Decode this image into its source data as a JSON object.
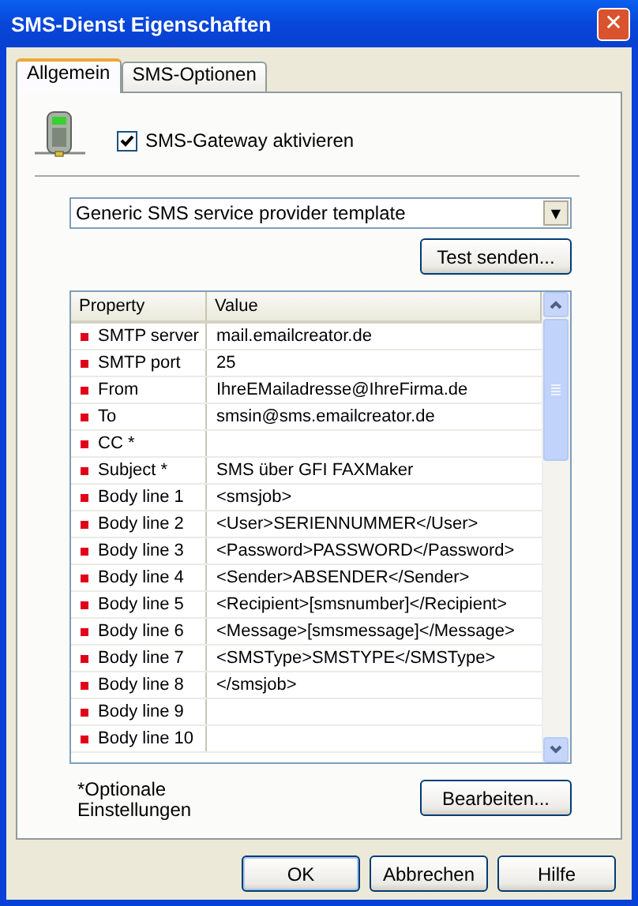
{
  "window": {
    "title": "SMS-Dienst Eigenschaften",
    "close": "✕"
  },
  "tabs": [
    {
      "label": "Allgemein",
      "selected": true
    },
    {
      "label": "SMS-Optionen",
      "selected": false
    }
  ],
  "gateway_checkbox": {
    "label": "SMS-Gateway aktivieren",
    "checked": true
  },
  "template_dropdown": {
    "value": "Generic SMS service provider template",
    "arrow": "▼"
  },
  "test_button": "Test senden...",
  "table": {
    "columns": [
      "Property",
      "Value"
    ],
    "rows": [
      {
        "property": "SMTP server",
        "value": "mail.emailcreator.de"
      },
      {
        "property": "SMTP port",
        "value": "25"
      },
      {
        "property": "From",
        "value": "IhreEMailadresse@IhreFirma.de"
      },
      {
        "property": "To",
        "value": "smsin@sms.emailcreator.de"
      },
      {
        "property": "CC *",
        "value": ""
      },
      {
        "property": "Subject *",
        "value": "SMS über GFI FAXMaker"
      },
      {
        "property": "Body line 1",
        "value": "<smsjob>"
      },
      {
        "property": "Body line 2",
        "value": "<User>SERIENNUMMER</User>"
      },
      {
        "property": "Body line 3",
        "value": "<Password>PASSWORD</Password>"
      },
      {
        "property": "Body line 4",
        "value": "<Sender>ABSENDER</Sender>"
      },
      {
        "property": "Body line 5",
        "value": "<Recipient>[smsnumber]</Recipient>"
      },
      {
        "property": "Body line 6",
        "value": "<Message>[smsmessage]</Message>"
      },
      {
        "property": "Body line 7",
        "value": "<SMSType>SMSTYPE</SMSType>"
      },
      {
        "property": "Body line 8",
        "value": "</smsjob>"
      },
      {
        "property": "Body line 9",
        "value": ""
      },
      {
        "property": "Body line 10",
        "value": ""
      }
    ]
  },
  "footnote": "*Optionale Einstellungen",
  "edit_button": "Bearbeiten...",
  "buttons": [
    "OK",
    "Abbrechen",
    "Hilfe"
  ]
}
